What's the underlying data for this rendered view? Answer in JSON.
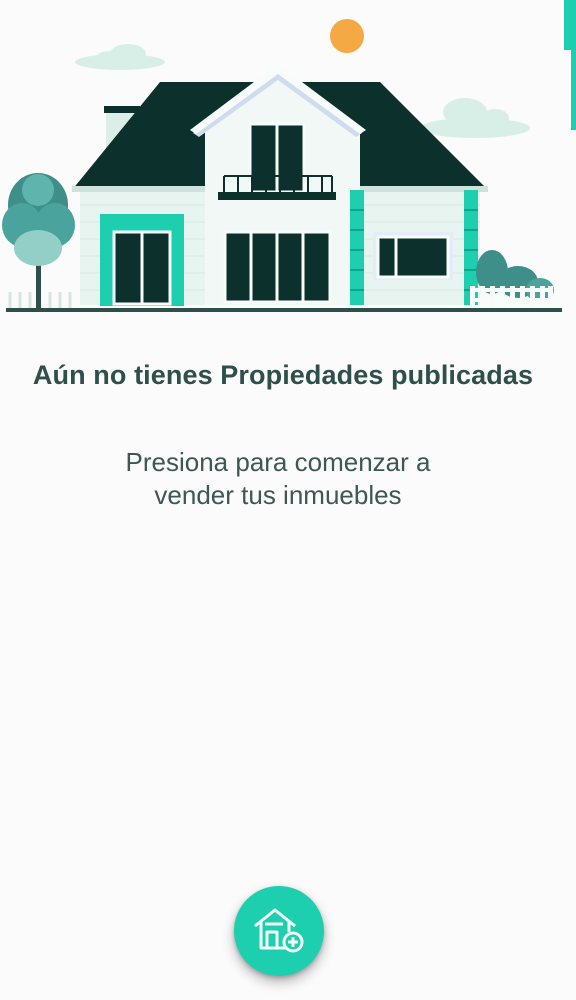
{
  "empty_state": {
    "title": "Aún no tienes Propiedades publicadas",
    "subtitle_line1": "Presiona para comenzar a",
    "subtitle_line2": "vender tus inmuebles"
  },
  "fab": {
    "icon": "add-house-icon"
  },
  "colors": {
    "accent": "#1dcfae",
    "roof": "#0c302b",
    "wall": "#e8f4ef",
    "sun": "#f5a944",
    "text": "#2e4f4a"
  }
}
